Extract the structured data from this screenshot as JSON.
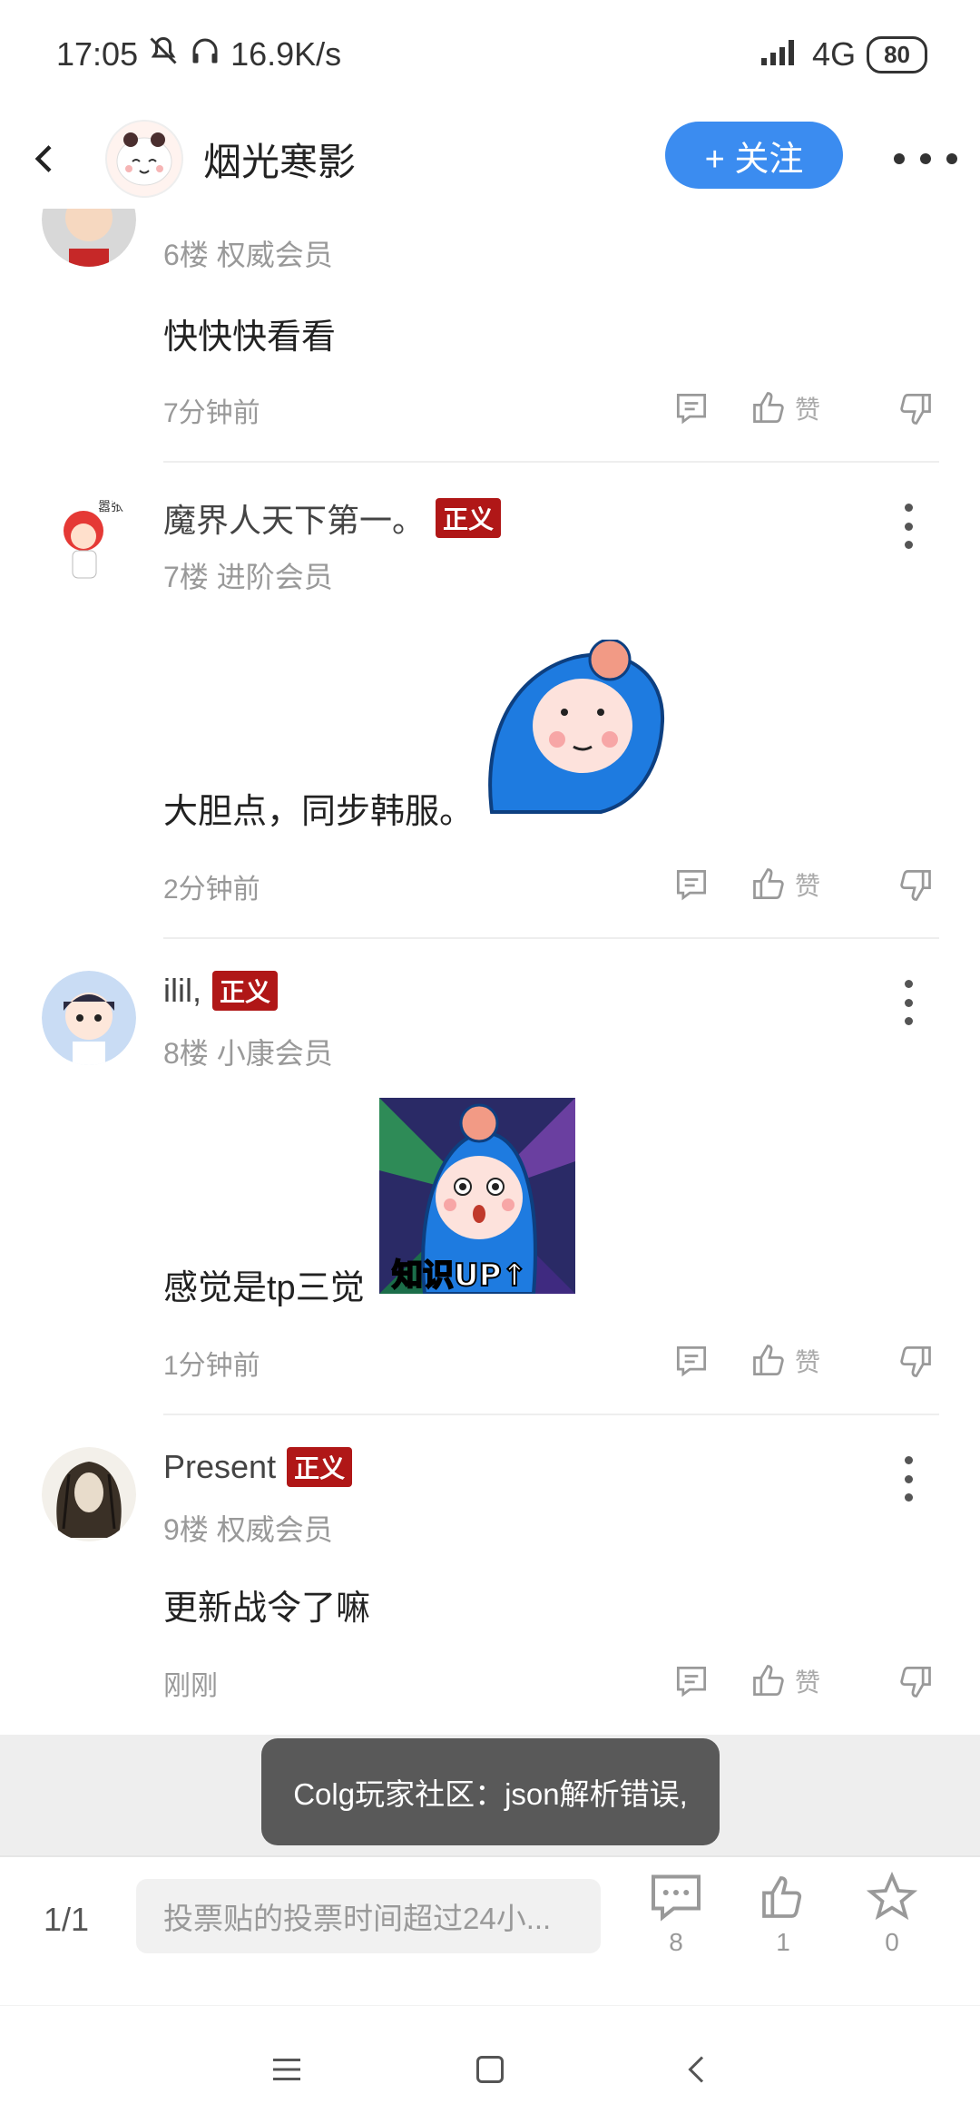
{
  "status_bar": {
    "time": "17:05",
    "speed": "16.9K/s",
    "network": "4G",
    "battery": "80",
    "icons": [
      "mute-icon",
      "headphone-icon",
      "signal-icon"
    ]
  },
  "header": {
    "title": "烟光寒影",
    "follow_label": "+ 关注"
  },
  "comments": [
    {
      "name": "",
      "meta": "6楼 权威会员",
      "body": "快快快看看",
      "time": "7分钟前",
      "like_label": "赞"
    },
    {
      "name": "魔界人天下第一。",
      "badge": "正义",
      "meta": "7楼 进阶会员",
      "body": "大胆点，同步韩服。",
      "time": "2分钟前",
      "like_label": "赞"
    },
    {
      "name": "ilil,",
      "badge": "正义",
      "meta": "8楼 小康会员",
      "body": "感觉是tp三觉",
      "sticker_text": "知识UP↑",
      "time": "1分钟前",
      "like_label": "赞"
    },
    {
      "name": "Present",
      "badge": "正义",
      "meta": "9楼 权威会员",
      "body": "更新战令了嘛",
      "time": "刚刚",
      "like_label": "赞"
    }
  ],
  "toast": "Colg玩家社区：json解析错误,",
  "bottom_bar": {
    "page": "1/1",
    "input_placeholder": "投票贴的投票时间超过24小...",
    "comment_count": "8",
    "like_count": "1",
    "star_count": "0"
  },
  "colors": {
    "accent": "#3b8cf0",
    "badge": "#b01717",
    "toast_bg": "#595959"
  }
}
